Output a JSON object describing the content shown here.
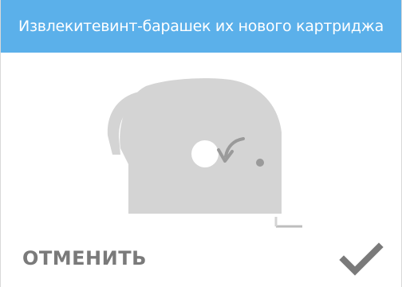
{
  "header": {
    "title": "Извлекитевинт-барашек их нового картриджа"
  },
  "illustration": {
    "icon": "cartridge-wingnut-illustration",
    "color": "#d4d4d4"
  },
  "footer": {
    "cancel_label": "ОТМЕНИТЬ",
    "confirm_icon": "checkmark-icon"
  },
  "colors": {
    "header_bg": "#5bb0ea",
    "header_text": "#ffffff",
    "button_text": "#7a7a7a"
  }
}
